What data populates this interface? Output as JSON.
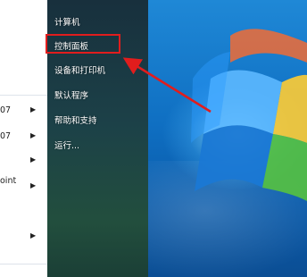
{
  "left_column": {
    "items": [
      {
        "label": "07",
        "has_arrow": true
      },
      {
        "label": "07",
        "has_arrow": true
      },
      {
        "label": "",
        "has_arrow": true
      },
      {
        "label": "oint",
        "has_arrow": true
      },
      {
        "label": "",
        "has_arrow": true
      }
    ]
  },
  "start_menu": {
    "items": [
      {
        "label": "计算机"
      },
      {
        "label": "控制面板"
      },
      {
        "label": "设备和打印机"
      },
      {
        "label": "默认程序"
      },
      {
        "label": "帮助和支持"
      },
      {
        "label": "运行..."
      }
    ],
    "highlighted": "控制面板"
  },
  "annotation": {
    "color": "#e11d1d"
  }
}
